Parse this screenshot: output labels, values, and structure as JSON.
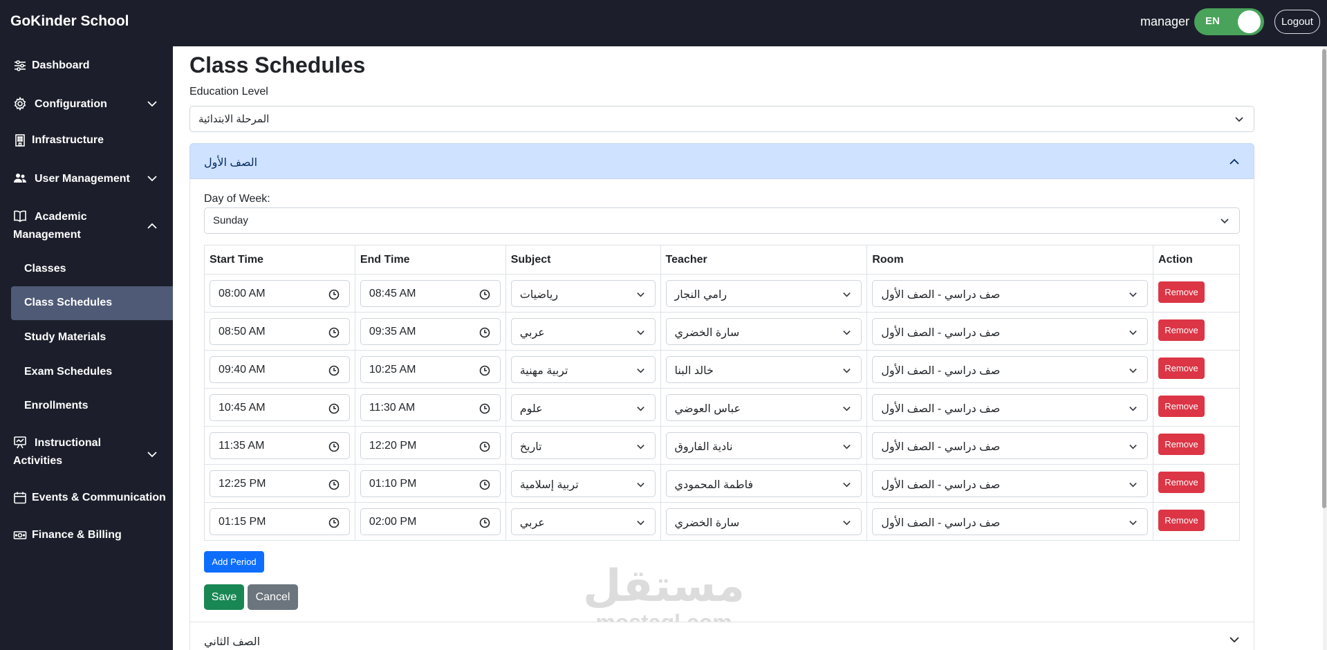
{
  "header": {
    "brand": "GoKinder School",
    "user": "manager",
    "lang": "EN",
    "logout": "Logout"
  },
  "sidebar": {
    "items": [
      {
        "label": "Dashboard",
        "icon": "sliders-icon"
      },
      {
        "label": "Configuration",
        "icon": "gear-icon"
      },
      {
        "label": "Infrastructure",
        "icon": "building-icon"
      },
      {
        "label": "User Management",
        "icon": "people-icon"
      },
      {
        "label": "Academic Management",
        "line1": "Academic",
        "line2": "Management",
        "icon": "book-icon"
      },
      {
        "label": "Instructional Activities",
        "line1": "Instructional",
        "line2": "Activities",
        "icon": "easel-icon"
      },
      {
        "label": "Events & Communication",
        "icon": "calendar-icon"
      },
      {
        "label": "Finance & Billing",
        "icon": "cash-icon"
      }
    ],
    "sub_items": [
      "Classes",
      "Class Schedules",
      "Study Materials",
      "Exam Schedules",
      "Enrollments"
    ],
    "active": "Class Schedules"
  },
  "page": {
    "title": "Class Schedules",
    "education_level_label": "Education Level",
    "education_level_value": "المرحلة الابتدائية"
  },
  "accordion": {
    "first_title": "الصف الأول",
    "second_title": "الصف الثاني",
    "day_label": "Day of Week:",
    "day_value": "Sunday"
  },
  "table": {
    "headers": [
      "Start Time",
      "End Time",
      "Subject",
      "Teacher",
      "Room",
      "Action"
    ],
    "rows": [
      {
        "start": "08:00 AM",
        "end": "08:45 AM",
        "subject": "رياضيات",
        "teacher": "رامي النجار",
        "room": "صف دراسي - الصف الأول"
      },
      {
        "start": "08:50 AM",
        "end": "09:35 AM",
        "subject": "عربي",
        "teacher": "سارة الخضري",
        "room": "صف دراسي - الصف الأول"
      },
      {
        "start": "09:40 AM",
        "end": "10:25 AM",
        "subject": "تربية مهنية",
        "teacher": "خالد البنا",
        "room": "صف دراسي - الصف الأول"
      },
      {
        "start": "10:45 AM",
        "end": "11:30 AM",
        "subject": "علوم",
        "teacher": "عباس العوضي",
        "room": "صف دراسي - الصف الأول"
      },
      {
        "start": "11:35 AM",
        "end": "12:20 PM",
        "subject": "تاريخ",
        "teacher": "نادية الفاروق",
        "room": "صف دراسي - الصف الأول"
      },
      {
        "start": "12:25 PM",
        "end": "01:10 PM",
        "subject": "تربية إسلامية",
        "teacher": "فاطمة المحمودي",
        "room": "صف دراسي - الصف الأول"
      },
      {
        "start": "01:15 PM",
        "end": "02:00 PM",
        "subject": "عربي",
        "teacher": "سارة الخضري",
        "room": "صف دراسي - الصف الأول"
      }
    ],
    "remove_label": "Remove"
  },
  "buttons": {
    "add_period": "Add Period",
    "save": "Save",
    "cancel": "Cancel"
  },
  "watermark": {
    "arabic": "مستقل",
    "latin": "mostaql.com"
  },
  "colors": {
    "sidebar_bg": "#1c1f2b",
    "active_item": "#4f5a76",
    "accordion_header": "#cfe2ff",
    "primary": "#0d6efd",
    "success": "#198754",
    "danger": "#dc3545",
    "secondary": "#6c757d",
    "toggle": "#4aa35b"
  }
}
